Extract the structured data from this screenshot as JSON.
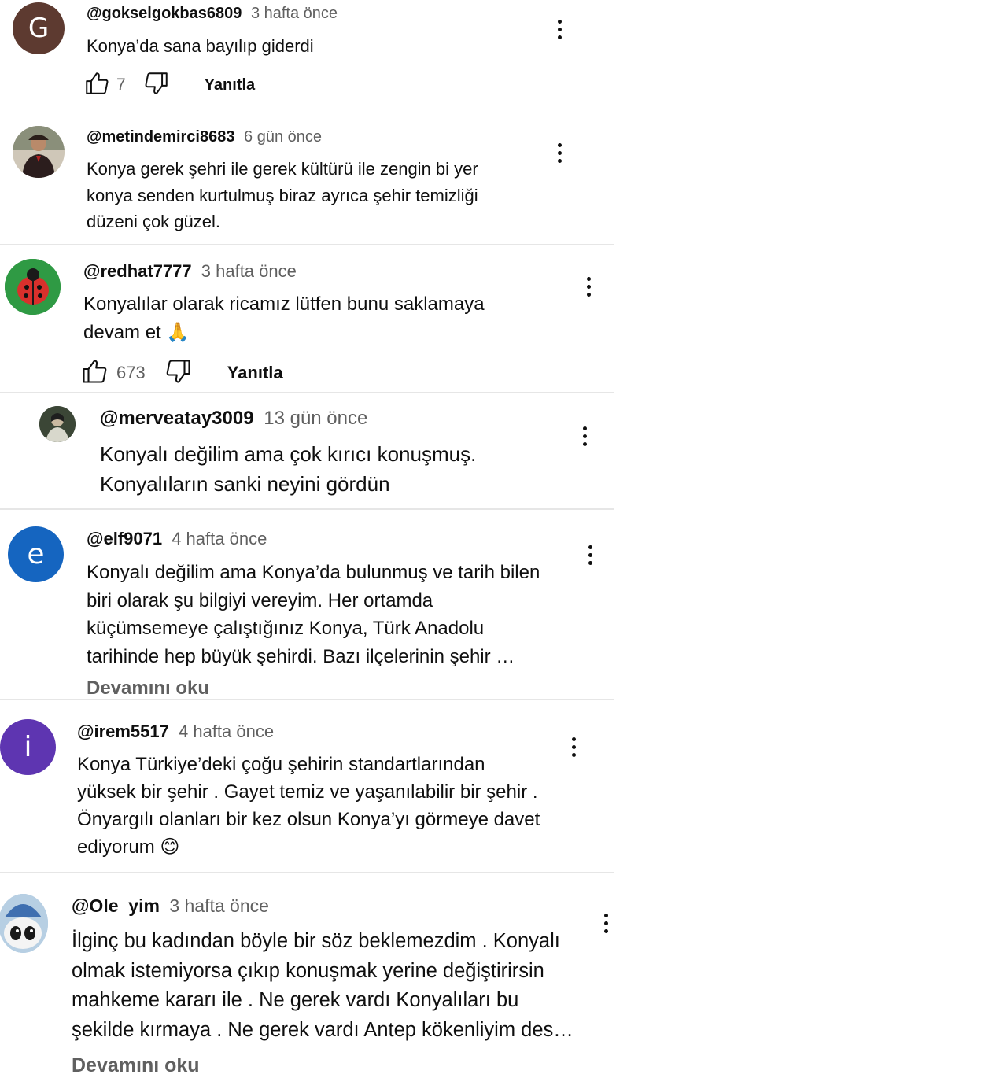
{
  "comments": [
    {
      "handle": "@gokselgokbas6809",
      "time": "3 hafta önce",
      "avatar_letter": "G",
      "avatar_color": "#5d3a30",
      "text": "Konya’da sana bayılıp giderdi",
      "likes": "7",
      "reply": "Yanıtla"
    },
    {
      "handle": "@metindemirci8683",
      "time": "6 gün önce",
      "text": "Konya gerek şehri ile gerek kültürü ile zengin bi yer\nkonya senden kurtulmuş biraz ayrıca şehir temizliği\ndüzeni çok güzel."
    },
    {
      "handle": "@redhat7777",
      "time": "3 hafta önce",
      "text": "Konyalılar olarak ricamız lütfen bunu saklamaya\ndevam et 🙏",
      "likes": "673",
      "reply": "Yanıtla"
    },
    {
      "handle": "@merveatay3009",
      "time": "13 gün önce",
      "text": "Konyalı değilim ama çok kırıcı konuşmuş.\nKonyalıların sanki neyini gördün"
    },
    {
      "handle": "@elf9071",
      "time": "4 hafta önce",
      "avatar_letter": "e",
      "avatar_color": "#1565c0",
      "text": "Konyalı değilim ama Konya’da bulunmuş ve tarih bilen\nbiri olarak şu bilgiyi vereyim. Her ortamda\nküçümsemeye çalıştığınız Konya, Türk Anadolu\ntarihinde hep büyük şehirdi. Bazı ilçelerinin şehir …",
      "read_more": "Devamını oku"
    },
    {
      "handle": "@irem5517",
      "time": "4 hafta önce",
      "avatar_letter": "i",
      "avatar_color": "#5e35b1",
      "text": "Konya Türkiye’deki çoğu şehirin standartlarından\nyüksek bir şehir . Gayet temiz ve yaşanılabilir bir şehir .\nÖnyargılı olanları bir kez olsun Konya’yı görmeye davet\nediyorum 😊"
    },
    {
      "handle": "@Ole_yim",
      "time": "3 hafta önce",
      "text": "İlginç bu kadından böyle bir söz beklemezdim . Konyalı\nolmak istemiyorsa çıkıp konuşmak yerine değiştirirsin\nmahkeme kararı ile . Ne gerek vardı Konyalıları bu\nşekilde kırmaya . Ne gerek vardı Antep kökenliyim des…",
      "read_more": "Devamını oku"
    }
  ],
  "icons": {
    "like": "thumb-up-icon",
    "dislike": "thumb-down-icon",
    "more": "more-vertical-icon"
  }
}
